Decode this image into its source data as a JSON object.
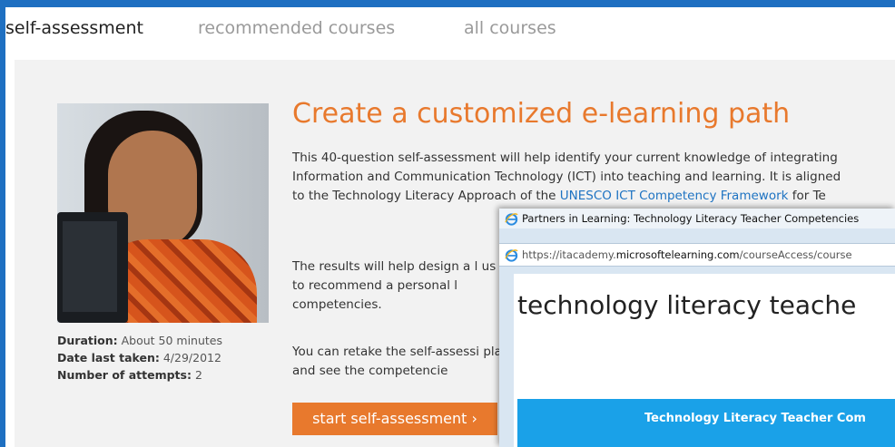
{
  "tabs": [
    {
      "label": "self-assessment",
      "active": true
    },
    {
      "label": "recommended courses",
      "active": false
    },
    {
      "label": "all courses",
      "active": false
    }
  ],
  "main": {
    "heading": "Create a customized e-learning path",
    "p1_a": "This 40-question self-assessment will help identify your current knowledge of integrating Information and Communication Technology (ICT) into teaching and learning. It is aligned to the Technology Literacy Approach of the ",
    "p1_link": "UNESCO ICT Competency Framework",
    "p1_b": " for Te",
    "p2": "The results will help design a l us to recommend a personal l competencies.",
    "p3": "You can retake the self-assessi plan and see the competencie",
    "cta_label": "start self-assessment ›"
  },
  "meta": {
    "duration_label": "Duration:",
    "duration_value": " About 50 minutes",
    "date_label": "Date last taken:",
    "date_value": " 4/29/2012",
    "attempts_label": "Number of attempts:",
    "attempts_value": " 2"
  },
  "popup": {
    "title": "Partners in Learning: Technology Literacy Teacher Competencies",
    "url_prefix": "https://itacademy.",
    "url_domain": "microsoftelearning.com",
    "url_suffix": "/courseAccess/course",
    "heading": "technology literacy teache",
    "banner": "Technology Literacy Teacher Com"
  },
  "colors": {
    "accent": "#e8792d",
    "link": "#1e73c2",
    "frame": "#1e6fc1",
    "banner": "#1aa1e8"
  },
  "icons": {
    "browser": "ie-icon"
  }
}
